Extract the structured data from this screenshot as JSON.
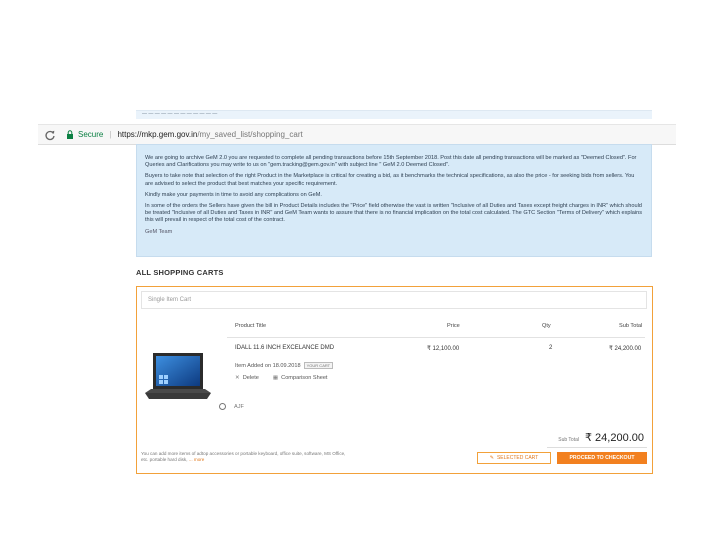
{
  "top_strip": {
    "text": "— — — — — — — — — — — —"
  },
  "browser": {
    "secure_label": "Secure",
    "url_host": "https://mkp.gem.gov.in",
    "url_path": "/my_saved_list/shopping_cart"
  },
  "notice": {
    "p1": "We are going to archive GeM 2.0 you are requested to complete all pending transactions before 15th September 2018. Post this date all pending transactions will be marked as \"Deemed Closed\". For Queries and Clarifications you may write to us on \"gem.tracking@gem.gov.in\" with subject line \" GeM 2.0 Deemed Closed\".",
    "p2": "Buyers to take note that selection of the right Product in the Marketplace is critical for creating a bid, as it benchmarks the technical specifications, as also the price - for seeking bids from sellers. You are advised to select the product that best matches your specific requirement.",
    "p3": "Kindly make your payments in time to avoid any complications on GeM.",
    "p4": "In some of the orders the Sellers have given the bill in Product Details includes the \"Price\" field otherwise the vast is written \"Inclusive of all Duties and Taxes except freight charges in INR\" which should be treated \"Inclusive of all Duties and Taxes in INR\" and GeM Team wants to assure that there is no financial implication on the total cost calculated. The GTC Section \"Terms of Delivery\" which explains this will prevail in respect of the total cost of the contract.",
    "contact": "GeM Team"
  },
  "cart": {
    "section_title": "ALL SHOPPING CARTS",
    "cart_type": "Single Item Cart",
    "headers": {
      "product": "Product Title",
      "price": "Price",
      "qty": "Qty",
      "subtotal": "Sub Total"
    },
    "item": {
      "title": "IDALL 11.6 INCH EXCELANCE DMD",
      "added": "Item Added on 18.09.2018",
      "badge": "YOUR CART",
      "price": "₹ 12,100.00",
      "qty": "2",
      "subtotal": "₹ 24,200.00",
      "delete_label": "Delete",
      "compare_label": "Comparison Sheet",
      "extra_label": "AJF"
    },
    "subtotal_label": "Sub Total",
    "subtotal_value": "₹ 24,200.00",
    "footer_note": "You can add more items of adtop accessories or portable keyboard, office suite, software, MS Office,",
    "footer_note2": "etc. portable hard disk,",
    "footer_more": "... more",
    "selected_cart_label": "SELECTED CART",
    "checkout_label": "PROCEED TO CHECKOUT"
  },
  "colors": {
    "accent": "#f2801f",
    "notice_bg": "#d7eaf8",
    "secure": "#0b8043"
  }
}
